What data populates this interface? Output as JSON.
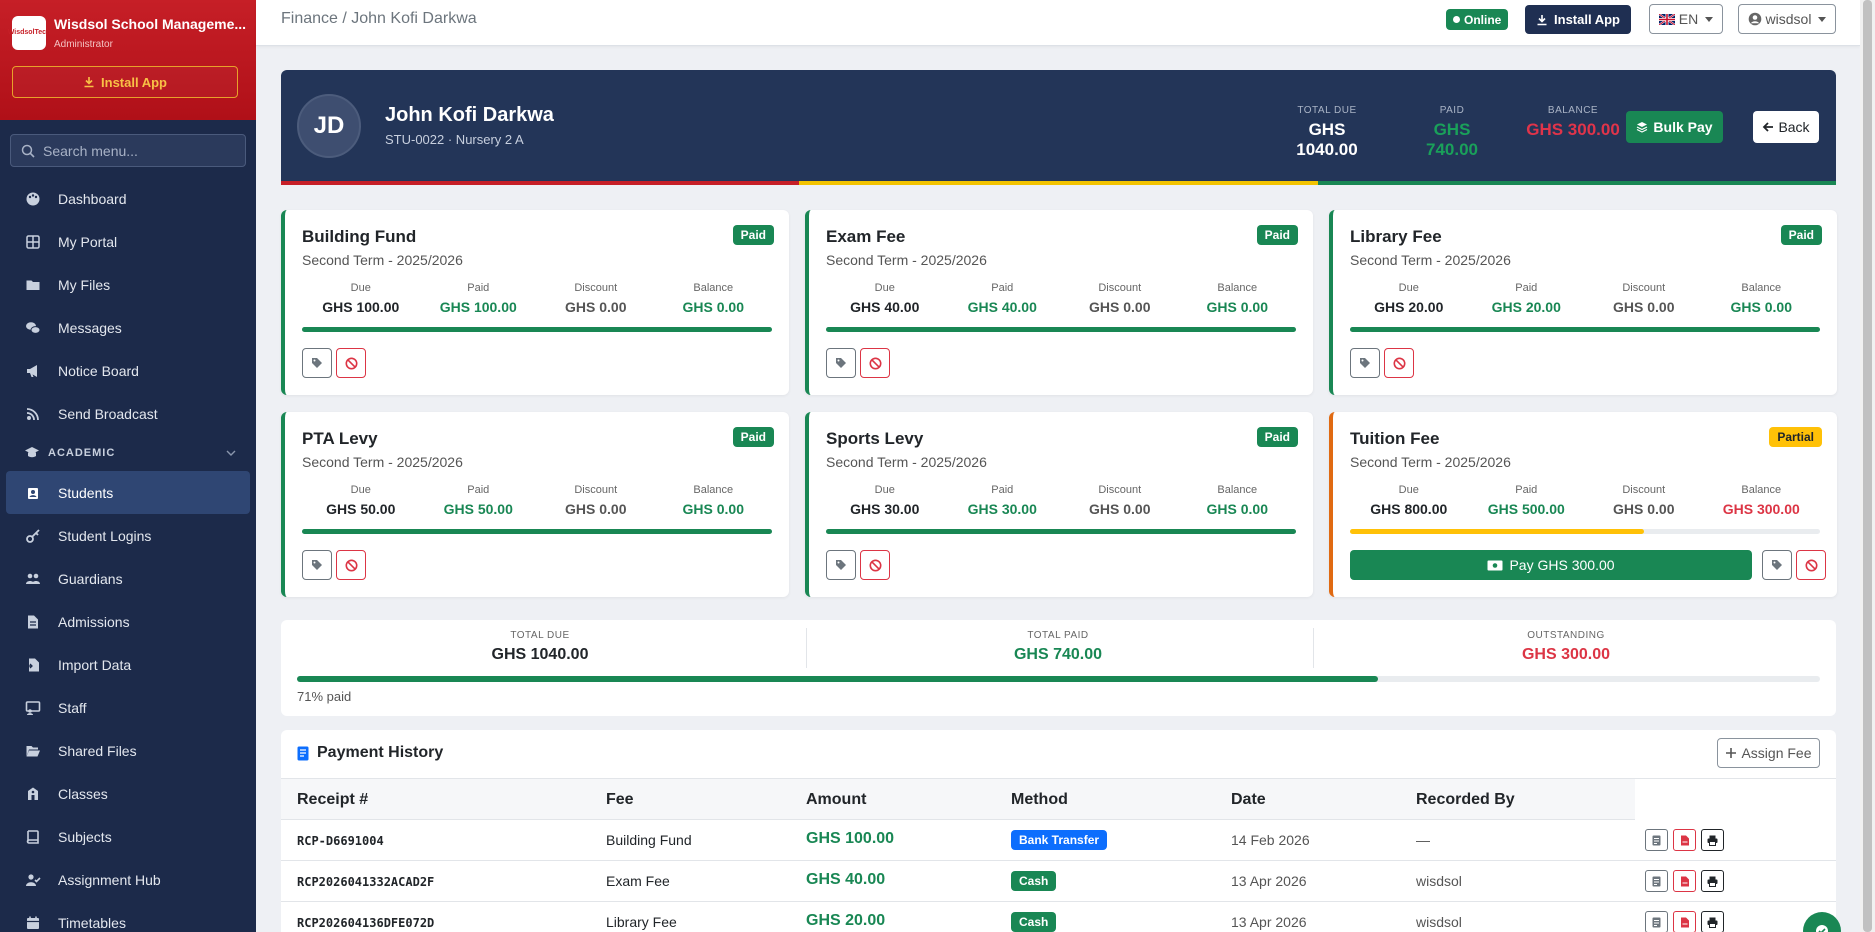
{
  "sidebar": {
    "brand_name": "Wisdsol School Manageme...",
    "role": "Administrator",
    "logo_text": "WisdsolTech",
    "install_label": "Install App",
    "search_placeholder": "Search menu...",
    "items": [
      {
        "label": "Dashboard",
        "icon": "palette-icon"
      },
      {
        "label": "My Portal",
        "icon": "grid-icon"
      },
      {
        "label": "My Files",
        "icon": "folder-icon"
      },
      {
        "label": "Messages",
        "icon": "chat-icon"
      },
      {
        "label": "Notice Board",
        "icon": "megaphone-icon"
      },
      {
        "label": "Send Broadcast",
        "icon": "broadcast-icon"
      }
    ],
    "section": "ACADEMIC",
    "academic_items": [
      {
        "label": "Students",
        "icon": "student-icon",
        "active": true
      },
      {
        "label": "Student Logins",
        "icon": "key-icon"
      },
      {
        "label": "Guardians",
        "icon": "users-icon"
      },
      {
        "label": "Admissions",
        "icon": "file-icon"
      },
      {
        "label": "Import Data",
        "icon": "file-import-icon"
      },
      {
        "label": "Staff",
        "icon": "chalkboard-icon"
      },
      {
        "label": "Shared Files",
        "icon": "folder-open-icon"
      },
      {
        "label": "Classes",
        "icon": "school-icon"
      },
      {
        "label": "Subjects",
        "icon": "book-icon"
      },
      {
        "label": "Assignment Hub",
        "icon": "user-task-icon"
      },
      {
        "label": "Timetables",
        "icon": "calendar-icon"
      }
    ]
  },
  "topbar": {
    "breadcrumb": "Finance / John Kofi Darkwa",
    "status": "Online",
    "install_label": "Install App",
    "lang": "EN",
    "user": "wisdsol"
  },
  "student": {
    "initials": "JD",
    "name": "John Kofi Darkwa",
    "sub": "STU-0022 · Nursery 2 A",
    "total_due_label": "TOTAL DUE",
    "total_due": "GHS 1040.00",
    "paid_label": "PAID",
    "paid": "GHS 740.00",
    "balance_label": "BALANCE",
    "balance": "GHS 300.00",
    "bulk_pay": "Bulk Pay",
    "back": "Back"
  },
  "fee_labels": {
    "due": "Due",
    "paid": "Paid",
    "discount": "Discount",
    "balance": "Balance"
  },
  "fees": [
    {
      "title": "Building Fund",
      "term": "Second Term - 2025/2026",
      "status": "Paid",
      "due": "GHS 100.00",
      "paid": "GHS 100.00",
      "discount": "GHS 0.00",
      "balance": "GHS 0.00",
      "progress": 1.0
    },
    {
      "title": "Exam Fee",
      "term": "Second Term - 2025/2026",
      "status": "Paid",
      "due": "GHS 40.00",
      "paid": "GHS 40.00",
      "discount": "GHS 0.00",
      "balance": "GHS 0.00",
      "progress": 1.0
    },
    {
      "title": "Library Fee",
      "term": "Second Term - 2025/2026",
      "status": "Paid",
      "due": "GHS 20.00",
      "paid": "GHS 20.00",
      "discount": "GHS 0.00",
      "balance": "GHS 0.00",
      "progress": 1.0
    },
    {
      "title": "PTA Levy",
      "term": "Second Term - 2025/2026",
      "status": "Paid",
      "due": "GHS 50.00",
      "paid": "GHS 50.00",
      "discount": "GHS 0.00",
      "balance": "GHS 0.00",
      "progress": 1.0
    },
    {
      "title": "Sports Levy",
      "term": "Second Term - 2025/2026",
      "status": "Paid",
      "due": "GHS 30.00",
      "paid": "GHS 30.00",
      "discount": "GHS 0.00",
      "balance": "GHS 0.00",
      "progress": 1.0
    },
    {
      "title": "Tuition Fee",
      "term": "Second Term - 2025/2026",
      "status": "Partial",
      "due": "GHS 800.00",
      "paid": "GHS 500.00",
      "discount": "GHS 0.00",
      "balance": "GHS 300.00",
      "progress": 0.625,
      "pay_label": "Pay GHS 300.00"
    }
  ],
  "summary": {
    "total_due_label": "TOTAL DUE",
    "total_due": "GHS 1040.00",
    "total_paid_label": "TOTAL PAID",
    "total_paid": "GHS 740.00",
    "outstanding_label": "OUTSTANDING",
    "outstanding": "GHS 300.00",
    "progress": 0.71,
    "pct_label": "71% paid"
  },
  "history": {
    "title": "Payment History",
    "assign_label": "Assign Fee",
    "columns": [
      "Receipt #",
      "Fee",
      "Amount",
      "Method",
      "Date",
      "Recorded By"
    ],
    "rows": [
      {
        "receipt": "RCP-D6691004",
        "fee": "Building Fund",
        "amount": "GHS 100.00",
        "method": "Bank Transfer",
        "date": "14 Feb 2026",
        "by": "—"
      },
      {
        "receipt": "RCP2026041332ACAD2F",
        "fee": "Exam Fee",
        "amount": "GHS 40.00",
        "method": "Cash",
        "date": "13 Apr 2026",
        "by": "wisdsol"
      },
      {
        "receipt": "RCP202604136DFE072D",
        "fee": "Library Fee",
        "amount": "GHS 20.00",
        "method": "Cash",
        "date": "13 Apr 2026",
        "by": "wisdsol"
      }
    ]
  },
  "colors": {
    "primary": "#233558",
    "success": "#198754",
    "danger": "#dc3545",
    "warning": "#ffc107",
    "stripe": [
      "#c61f27",
      "#f2c300",
      "#198754"
    ]
  }
}
